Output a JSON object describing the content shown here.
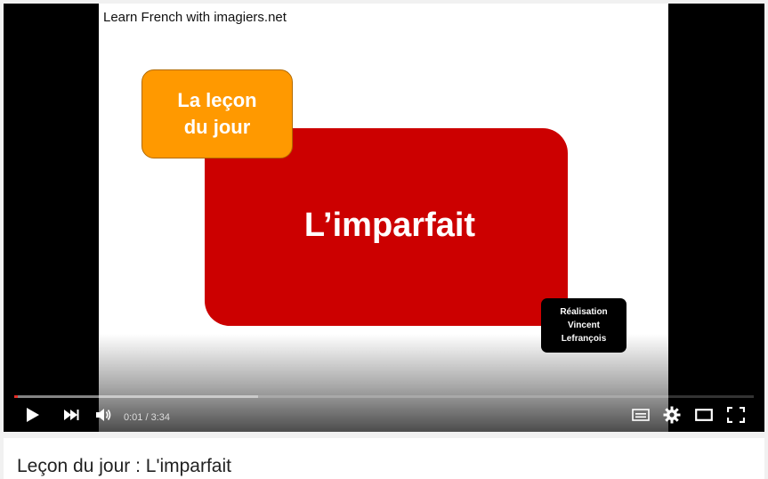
{
  "slide": {
    "channel_title": "Learn French with imagiers.net",
    "badge_text": "La leçon\ndu jour",
    "main_title": "L’imparfait",
    "credit_text": "Réalisation\nVincent\nLefrançois"
  },
  "player": {
    "current_time": "0:01",
    "separator": " / ",
    "duration": "3:34",
    "played_fraction": 0.005,
    "buffered_fraction": 0.33,
    "icons": {
      "play": "play-icon",
      "next": "next-icon",
      "volume": "volume-icon",
      "subtitles": "subtitles-icon",
      "settings": "gear-icon",
      "theater": "theater-mode-icon",
      "fullscreen": "fullscreen-icon"
    },
    "colors": {
      "played": "#e52d27",
      "orange": "#ff9900",
      "red": "#cc0000"
    }
  },
  "video": {
    "title": "Leçon du jour : L'imparfait"
  }
}
